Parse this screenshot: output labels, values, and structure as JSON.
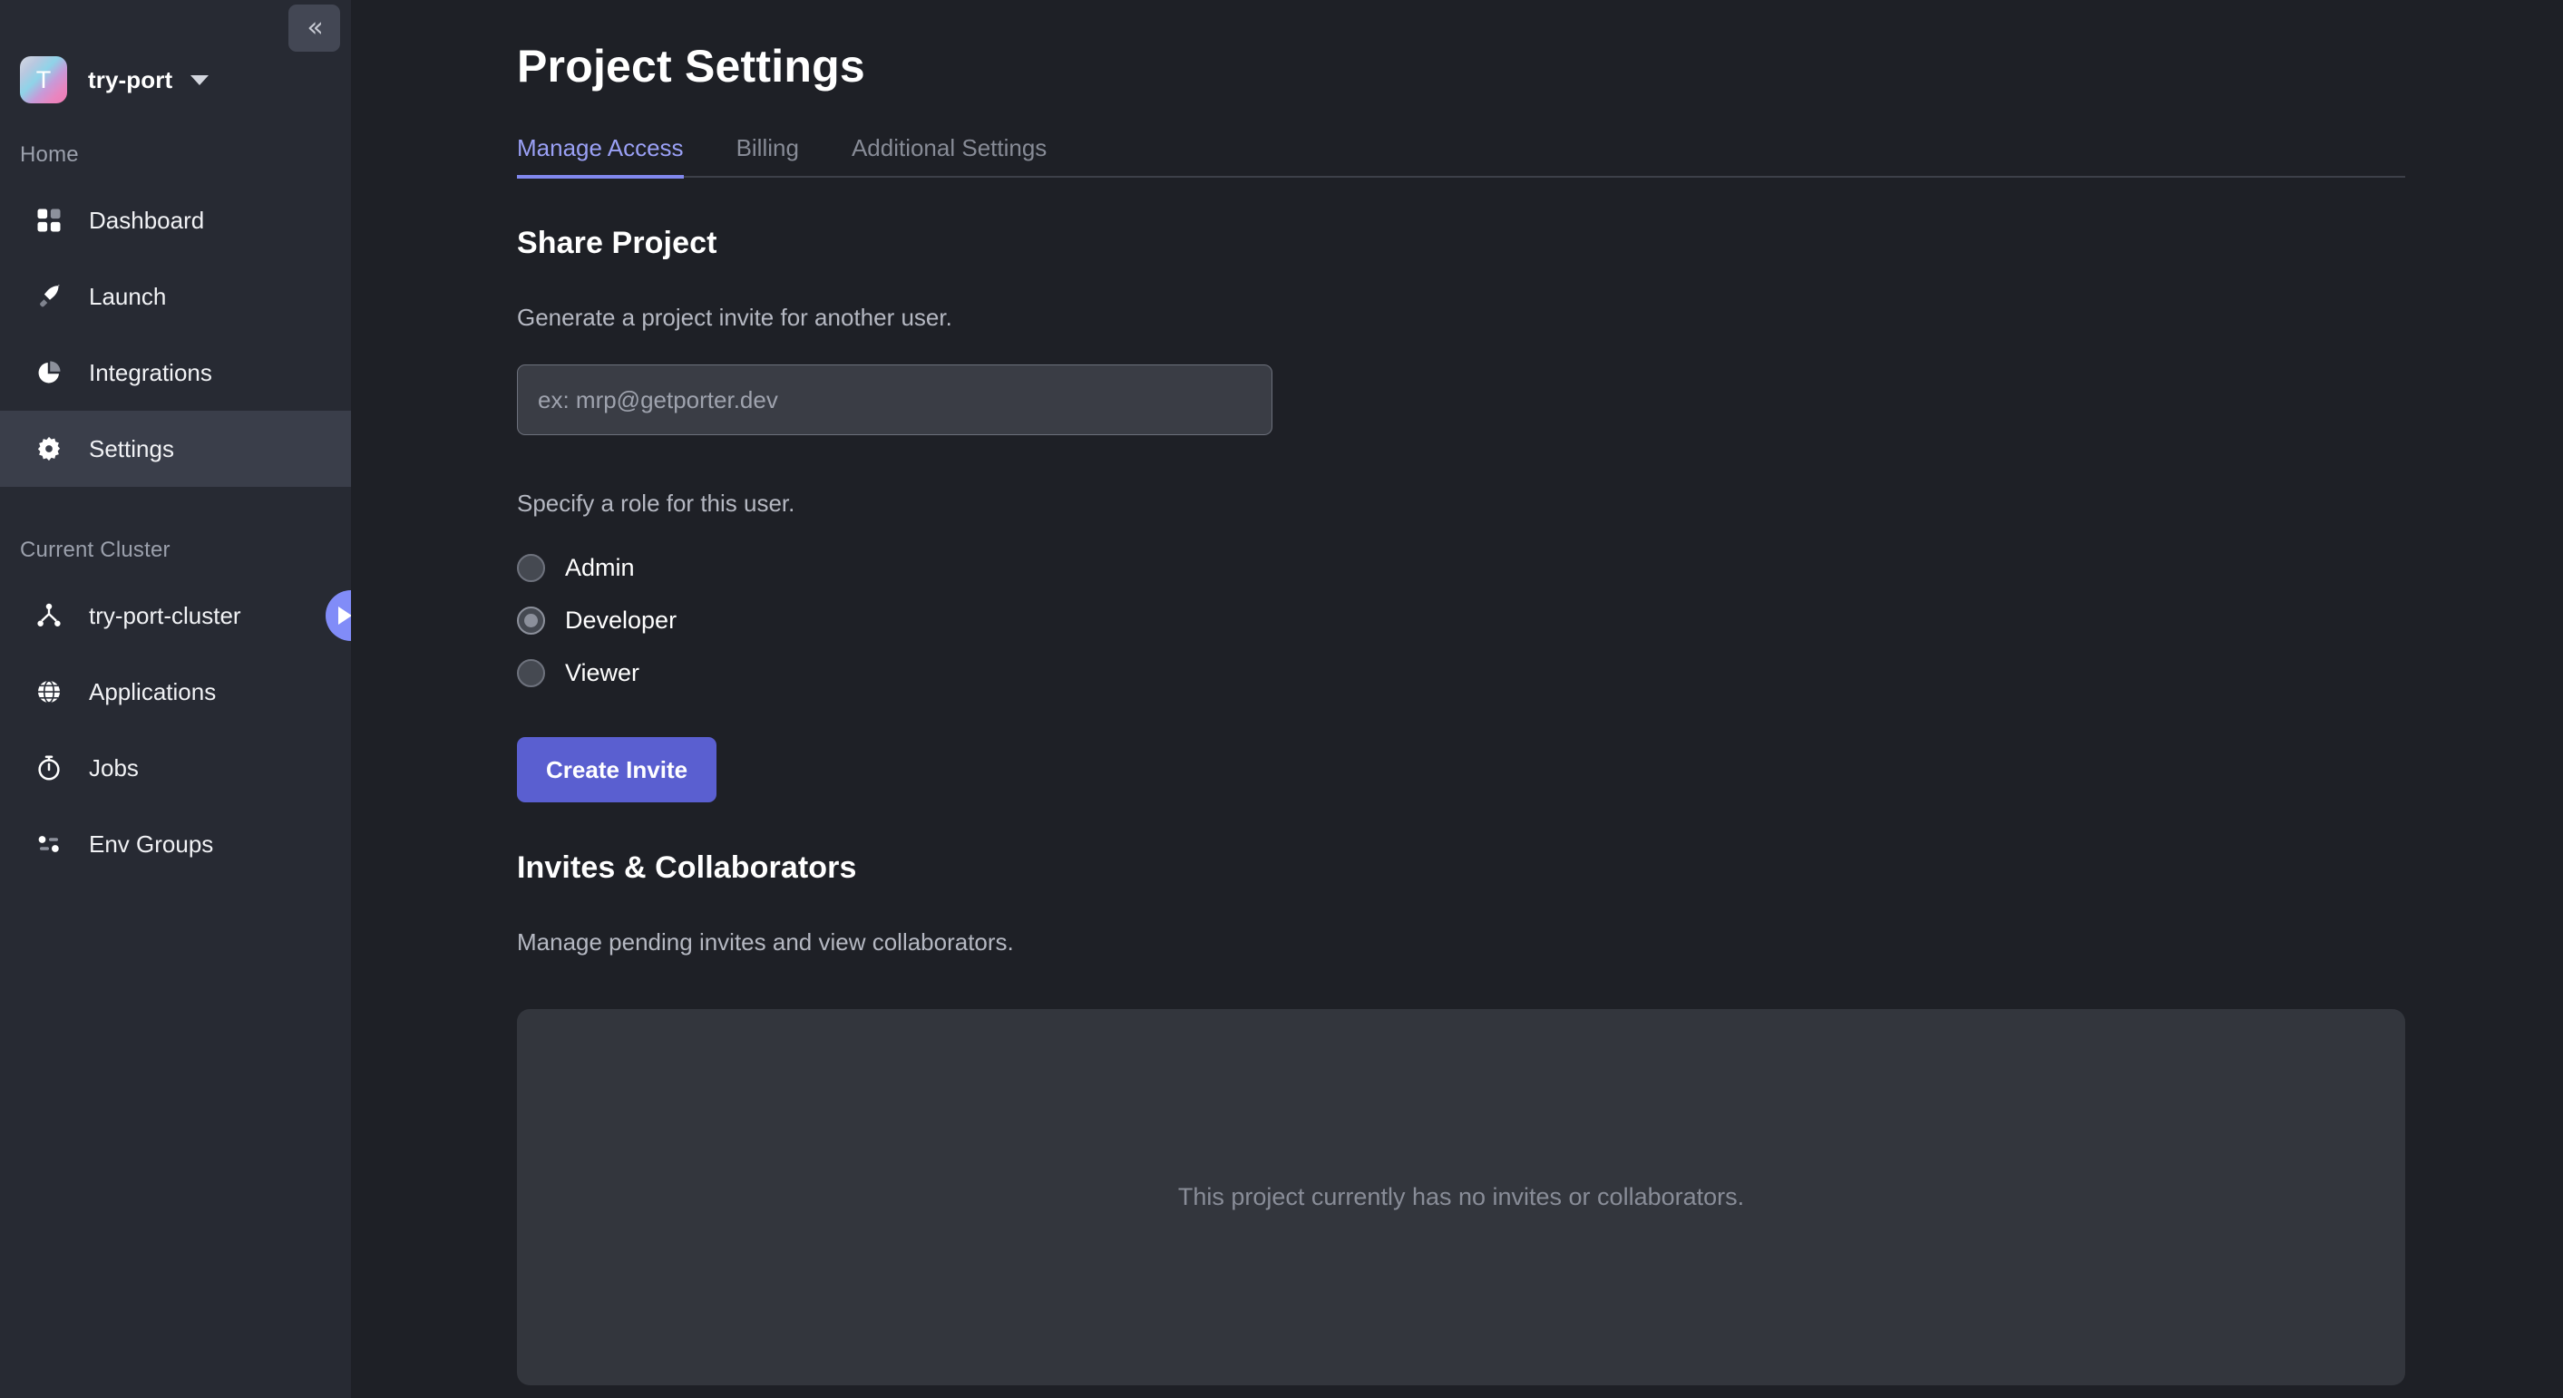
{
  "sidebar": {
    "collapse_button": {
      "glyph": "«",
      "icon": "chevron-double-left-icon"
    },
    "project": {
      "avatar_letter": "T",
      "name": "try-port",
      "caret_icon": "chevron-down-icon"
    },
    "groups": [
      {
        "label": "Home",
        "items": [
          {
            "label": "Dashboard",
            "icon": "dashboard-grid-icon",
            "active": false
          },
          {
            "label": "Launch",
            "icon": "rocket-icon",
            "active": false
          },
          {
            "label": "Integrations",
            "icon": "pie-chart-icon",
            "active": false
          },
          {
            "label": "Settings",
            "icon": "gear-icon",
            "active": true
          }
        ]
      },
      {
        "label": "Current Cluster",
        "items": [
          {
            "label": "try-port-cluster",
            "icon": "cluster-nodes-icon",
            "active": false,
            "badge_icon": "play-arrow-icon"
          },
          {
            "label": "Applications",
            "icon": "globe-icon",
            "active": false
          },
          {
            "label": "Jobs",
            "icon": "stopwatch-icon",
            "active": false
          },
          {
            "label": "Env Groups",
            "icon": "env-list-icon",
            "active": false
          }
        ]
      }
    ]
  },
  "main": {
    "page_title": "Project Settings",
    "tabs": [
      {
        "label": "Manage Access",
        "active": true
      },
      {
        "label": "Billing",
        "active": false
      },
      {
        "label": "Additional Settings",
        "active": false
      }
    ],
    "share_project": {
      "title": "Share Project",
      "subtitle": "Generate a project invite for another user.",
      "email_placeholder": "ex: mrp@getporter.dev",
      "email_value": "",
      "role_label": "Specify a role for this user.",
      "roles": [
        {
          "label": "Admin",
          "checked": false
        },
        {
          "label": "Developer",
          "checked": true
        },
        {
          "label": "Viewer",
          "checked": false
        }
      ],
      "create_invite_label": "Create Invite"
    },
    "invites": {
      "title": "Invites & Collaborators",
      "subtitle": "Manage pending invites and view collaborators.",
      "empty_text": "This project currently has no invites or collaborators."
    }
  },
  "colors": {
    "sidebar_bg": "#272a33",
    "main_bg": "#1e2026",
    "accent_purple": "#5a5fd0",
    "tab_active": "#9aa0f5",
    "badge_purple": "#818cf8",
    "panel_bg": "#33363d"
  }
}
